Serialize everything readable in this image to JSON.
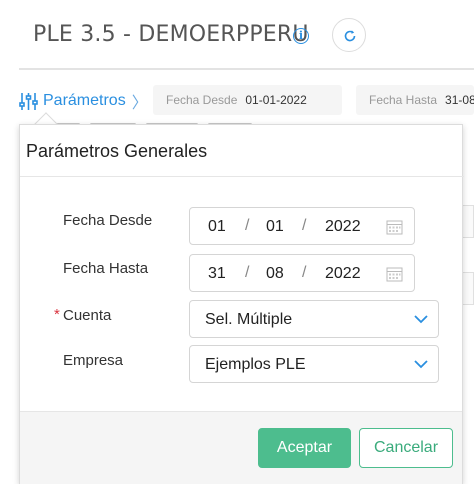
{
  "header": {
    "title": "PLE 3.5 - DEMOERPPERU",
    "info_icon": "info-icon",
    "refresh_icon": "refresh-icon"
  },
  "toolbar": {
    "params_label": "Parámetros",
    "params_icon": "sliders-icon",
    "filters": [
      {
        "label": "Fecha Desde",
        "value": "01-01-2022"
      },
      {
        "label": "Fecha Hasta",
        "value": "31-08"
      }
    ]
  },
  "modal": {
    "title": "Parámetros Generales",
    "fields": {
      "fecha_desde": {
        "label": "Fecha Desde",
        "day": "01",
        "month": "01",
        "year": "2022"
      },
      "fecha_hasta": {
        "label": "Fecha Hasta",
        "day": "31",
        "month": "08",
        "year": "2022"
      },
      "cuenta": {
        "label": "Cuenta",
        "required_mark": "*",
        "value": "Sel. Múltiple"
      },
      "empresa": {
        "label": "Empresa",
        "value": "Ejemplos PLE"
      }
    },
    "date_separator": "/",
    "accept_label": "Aceptar",
    "cancel_label": "Cancelar"
  },
  "colors": {
    "accent_blue": "#2a8fe0",
    "accept_green": "#4dbd8e",
    "required_red": "#d9333f"
  }
}
